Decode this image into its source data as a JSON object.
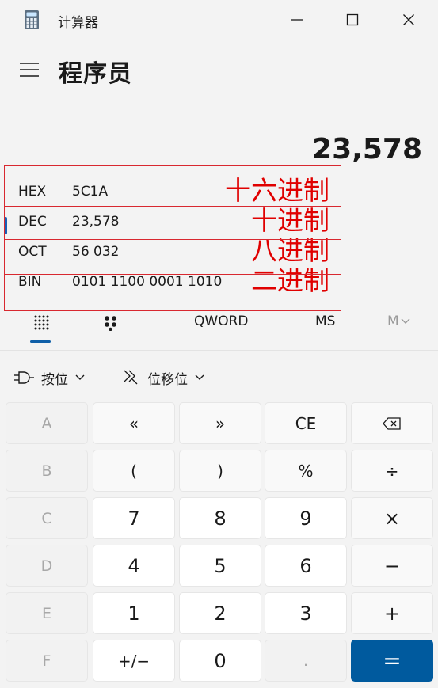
{
  "window": {
    "title": "计算器"
  },
  "header": {
    "mode_title": "程序员"
  },
  "display": {
    "value": "23,578"
  },
  "radix": [
    {
      "label": "HEX",
      "value": "5C1A",
      "annotation": "十六进制",
      "active": false
    },
    {
      "label": "DEC",
      "value": "23,578",
      "annotation": "十进制",
      "active": true
    },
    {
      "label": "OCT",
      "value": "56 032",
      "annotation": "八进制",
      "active": false
    },
    {
      "label": "BIN",
      "value": "0101 1100 0001 1010",
      "annotation": "二进制",
      "active": false
    }
  ],
  "modebar": {
    "word_size": "QWORD",
    "ms": "MS",
    "m_dropdown": "M"
  },
  "ops": {
    "bitwise": "按位",
    "bitshift": "位移位"
  },
  "keys": [
    [
      "A",
      "«",
      "»",
      "CE",
      "⌫"
    ],
    [
      "B",
      "(",
      ")",
      "%",
      "÷"
    ],
    [
      "C",
      "7",
      "8",
      "9",
      "×"
    ],
    [
      "D",
      "4",
      "5",
      "6",
      "−"
    ],
    [
      "E",
      "1",
      "2",
      "3",
      "+"
    ],
    [
      "F",
      "+/−",
      "0",
      ".",
      "="
    ]
  ],
  "colors": {
    "accent": "#005a9e",
    "annotation": "#e00000"
  }
}
